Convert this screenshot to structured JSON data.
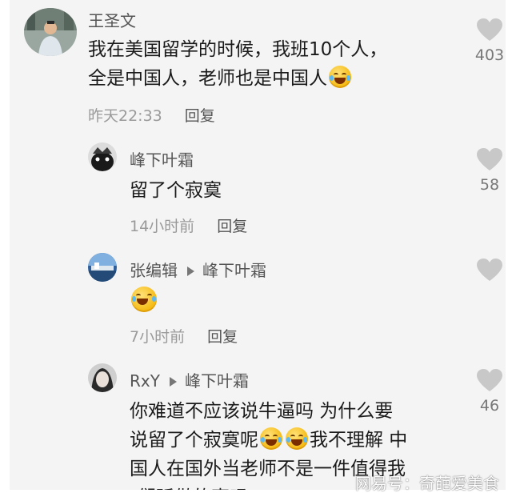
{
  "comments": [
    {
      "username": "王圣文",
      "text_line1": "我在美国留学的时候，我班10个人，",
      "text_line2": "全是中国人，老师也是中国人",
      "time": "昨天22:33",
      "reply_label": "回复",
      "like_count": "403"
    },
    {
      "username": "峰下叶霜",
      "text": "留了个寂寞",
      "time": "14小时前",
      "reply_label": "回复",
      "like_count": "58"
    },
    {
      "username": "张编辑",
      "reply_to": "峰下叶霜",
      "time": "7小时前",
      "reply_label": "回复"
    },
    {
      "username": "RxY",
      "reply_to": "峰下叶霜",
      "text_line1": "你难道不应该说牛逼吗 为什么要",
      "text_line2a": "说留了个寂寞呢",
      "text_line2b": "我不理解 中",
      "text_line3": "国人在国外当老师不是一件值得我",
      "text_line4": "们骄傲的事吗",
      "like_count": "46"
    }
  ],
  "watermark": "网易号：奇葩爱美食",
  "icons": {
    "like": "heart-icon",
    "reply_arrow": "play-triangle-icon",
    "emoji": "rolling-on-floor-laughing-emoji"
  },
  "colors": {
    "background": "#f4f4f4",
    "username": "#555555",
    "meta": "#9a9a9a",
    "heart": "#c8c8c8"
  }
}
